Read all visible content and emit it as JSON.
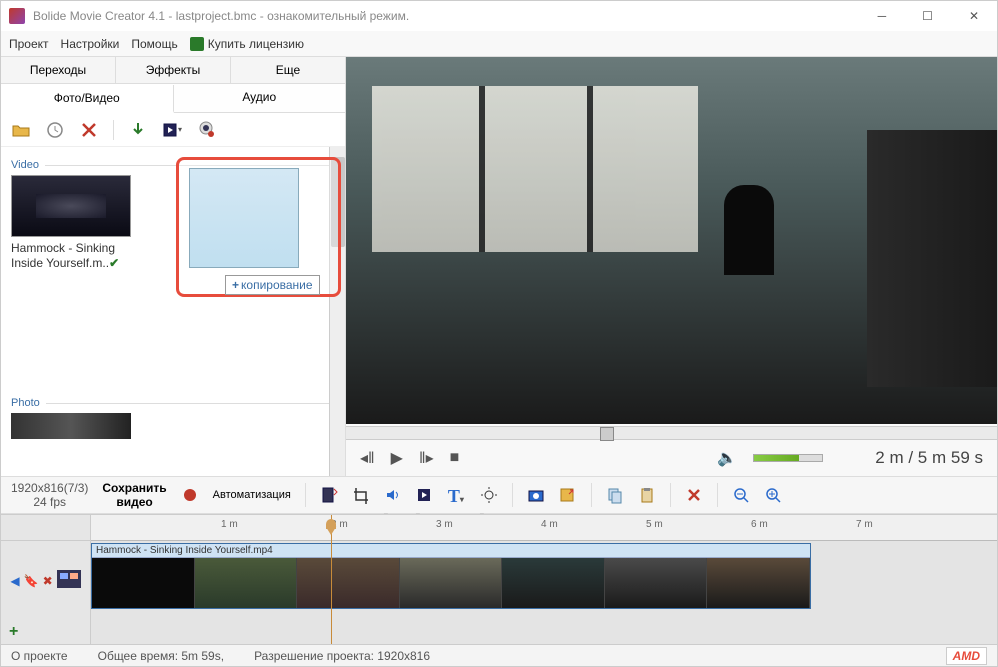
{
  "window": {
    "title": "Bolide Movie Creator 4.1 - lastproject.bmc  - ознакомительный режим."
  },
  "menu": {
    "project": "Проект",
    "settings": "Настройки",
    "help": "Помощь",
    "buy": "Купить лицензию"
  },
  "tabs": {
    "transitions": "Переходы",
    "effects": "Эффекты",
    "more": "Еще",
    "photo_video": "Фото/Видео",
    "audio": "Аудио"
  },
  "sections": {
    "video": "Video",
    "photo": "Photo"
  },
  "media": {
    "clip1": "Hammock - Sinking Inside Yourself.m..",
    "drag_tooltip": "копирование"
  },
  "player": {
    "time": "2 m   / 5 m 59 s"
  },
  "midbar": {
    "resolution": "1920x816(7/3)",
    "fps": "24 fps",
    "save": "Сохранить\nвидео",
    "automation": "Автоматизация"
  },
  "timeline": {
    "marks": [
      "1 m",
      "2 m",
      "3 m",
      "4 m",
      "5 m",
      "6 m",
      "7 m"
    ],
    "clip_title": "Hammock - Sinking Inside Yourself.mp4"
  },
  "status": {
    "about": "О проекте",
    "total": "Общее время: 5m 59s,",
    "res": "Разрешение проекта:    1920x816",
    "amd": "AMD"
  }
}
